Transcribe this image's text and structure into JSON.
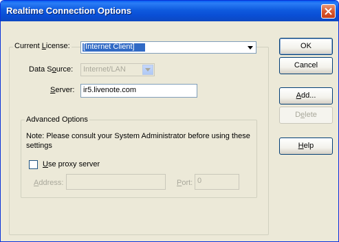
{
  "window": {
    "title": "Realtime Connection Options",
    "close_icon": "close-icon"
  },
  "license": {
    "label_pre": "Current ",
    "label_accel": "L",
    "label_post": "icense:",
    "selected": "[Internet Client]"
  },
  "data_source": {
    "label_pre": "Data S",
    "label_accel": "o",
    "label_post": "urce:",
    "selected": "Internet/LAN"
  },
  "server": {
    "label_pre": "",
    "label_accel": "S",
    "label_post": "erver:",
    "value": "ir5.livenote.com"
  },
  "advanced": {
    "title": "Advanced Options",
    "note": "Note: Please consult your System Administrator before using these settings",
    "proxy": {
      "label_pre": "",
      "label_accel": "U",
      "label_post": "se proxy server",
      "checked": false
    },
    "address": {
      "label_pre": "",
      "label_accel": "A",
      "label_post": "ddress:",
      "value": ""
    },
    "port": {
      "label_pre": "",
      "label_accel": "P",
      "label_post": "ort:",
      "value": "0"
    }
  },
  "buttons": {
    "ok": "OK",
    "cancel": "Cancel",
    "add": {
      "pre": "",
      "accel": "A",
      "post": "dd..."
    },
    "delete": {
      "pre": "D",
      "accel": "e",
      "post": "lete"
    },
    "help": {
      "pre": "",
      "accel": "H",
      "post": "elp"
    }
  }
}
